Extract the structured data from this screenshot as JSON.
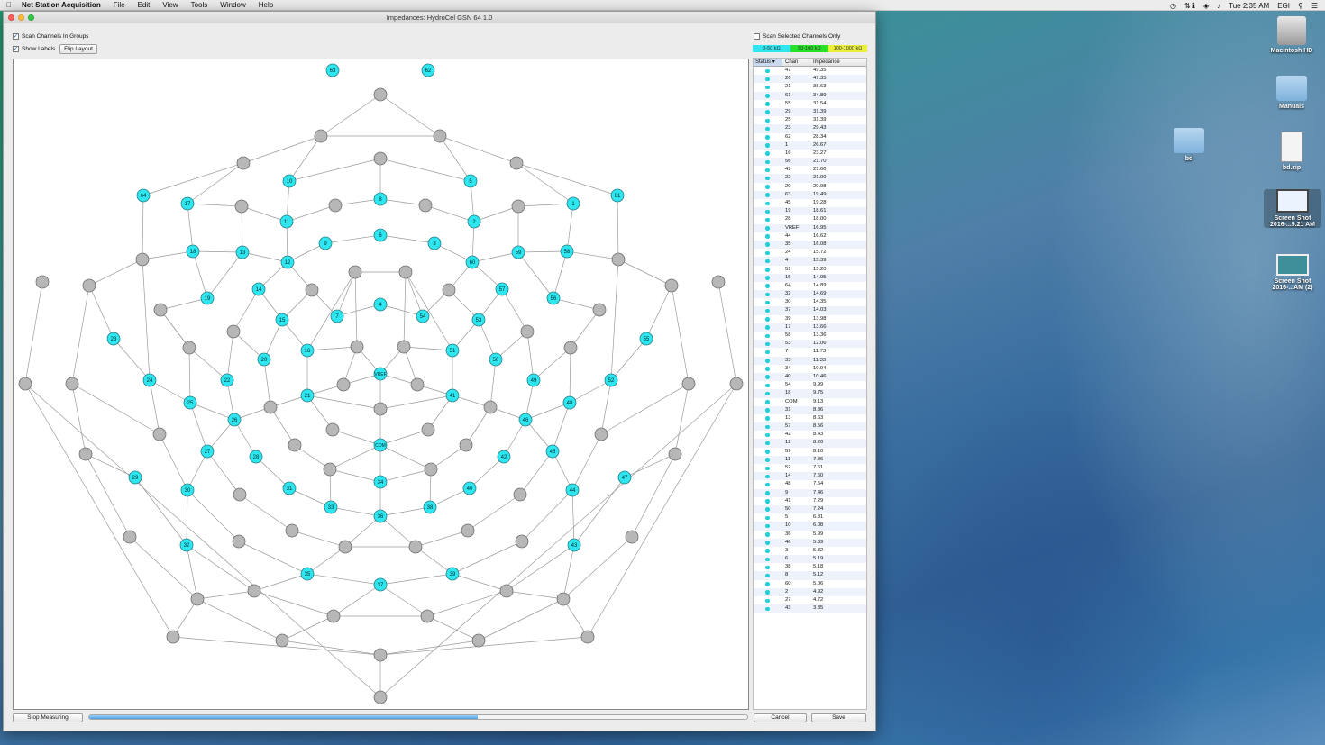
{
  "menubar": {
    "apple": "",
    "app": "Net Station Acquisition",
    "items": [
      "File",
      "Edit",
      "View",
      "Tools",
      "Window",
      "Help"
    ],
    "extra": "⇅ ℹ",
    "clock": "Tue 2:35 AM",
    "user": "EGI"
  },
  "window": {
    "title": "Impedances: HydroCel GSN 64 1.0"
  },
  "options": {
    "scan_groups": "Scan Channels In Groups",
    "show_labels": "Show Labels",
    "flip_layout": "Flip Layout",
    "scan_selected": "Scan Selected Channels Only"
  },
  "legend": {
    "low": "0-50 kΩ",
    "mid": "50-100 kΩ",
    "high": "100-1000 kΩ",
    "colors": {
      "low": "#2de6ef",
      "mid": "#27e028",
      "high": "#ecf03a"
    }
  },
  "table": {
    "headers": {
      "status": "Status",
      "chan": "Chan",
      "impedance": "Impedance"
    },
    "rows": [
      [
        "47",
        "49.35"
      ],
      [
        "26",
        "47.35"
      ],
      [
        "21",
        "38.63"
      ],
      [
        "61",
        "34.89"
      ],
      [
        "55",
        "31.54"
      ],
      [
        "29",
        "31.39"
      ],
      [
        "25",
        "31.39"
      ],
      [
        "23",
        "29.43"
      ],
      [
        "62",
        "28.34"
      ],
      [
        "1",
        "26.67"
      ],
      [
        "16",
        "23.27"
      ],
      [
        "56",
        "21.70"
      ],
      [
        "49",
        "21.60"
      ],
      [
        "22",
        "21.00"
      ],
      [
        "20",
        "20.98"
      ],
      [
        "63",
        "19.49"
      ],
      [
        "45",
        "19.28"
      ],
      [
        "19",
        "18.61"
      ],
      [
        "28",
        "18.00"
      ],
      [
        "VREF",
        "16.95"
      ],
      [
        "44",
        "16.62"
      ],
      [
        "35",
        "16.08"
      ],
      [
        "24",
        "15.72"
      ],
      [
        "4",
        "15.39"
      ],
      [
        "51",
        "15.20"
      ],
      [
        "15",
        "14.95"
      ],
      [
        "64",
        "14.89"
      ],
      [
        "32",
        "14.69"
      ],
      [
        "30",
        "14.35"
      ],
      [
        "37",
        "14.03"
      ],
      [
        "39",
        "13.98"
      ],
      [
        "17",
        "13.66"
      ],
      [
        "58",
        "13.36"
      ],
      [
        "53",
        "12.06"
      ],
      [
        "7",
        "11.73"
      ],
      [
        "33",
        "11.33"
      ],
      [
        "34",
        "10.94"
      ],
      [
        "40",
        "10.46"
      ],
      [
        "54",
        "9.99"
      ],
      [
        "18",
        "9.75"
      ],
      [
        "COM",
        "9.13"
      ],
      [
        "31",
        "8.86"
      ],
      [
        "13",
        "8.63"
      ],
      [
        "57",
        "8.56"
      ],
      [
        "42",
        "8.43"
      ],
      [
        "12",
        "8.20"
      ],
      [
        "59",
        "8.10"
      ],
      [
        "11",
        "7.86"
      ],
      [
        "52",
        "7.61"
      ],
      [
        "14",
        "7.60"
      ],
      [
        "48",
        "7.54"
      ],
      [
        "9",
        "7.46"
      ],
      [
        "41",
        "7.29"
      ],
      [
        "50",
        "7.24"
      ],
      [
        "5",
        "6.81"
      ],
      [
        "10",
        "6.08"
      ],
      [
        "36",
        "5.99"
      ],
      [
        "46",
        "5.89"
      ],
      [
        "3",
        "5.32"
      ],
      [
        "6",
        "5.19"
      ],
      [
        "38",
        "5.18"
      ],
      [
        "8",
        "5.12"
      ],
      [
        "60",
        "5.06"
      ],
      [
        "2",
        "4.92"
      ],
      [
        "27",
        "4.72"
      ],
      [
        "43",
        "3.35"
      ]
    ]
  },
  "buttons": {
    "stop": "Stop Measuring",
    "cancel": "Cancel",
    "save": "Save"
  },
  "progress": 0.59,
  "desktop": {
    "icons": [
      {
        "label": "Macintosh HD",
        "icon": "hard-drive-icon"
      },
      {
        "label": "Manuals",
        "icon": "folder-icon"
      },
      {
        "label": "bd",
        "icon": "folder-icon"
      },
      {
        "label": "bd.zip",
        "icon": "zip-file-icon"
      },
      {
        "label": "Screen Shot 2016-...9.21 AM",
        "icon": "screenshot-icon"
      },
      {
        "label": "Screen Shot 2016-...AM (2)",
        "icon": "screenshot-icon"
      }
    ]
  }
}
